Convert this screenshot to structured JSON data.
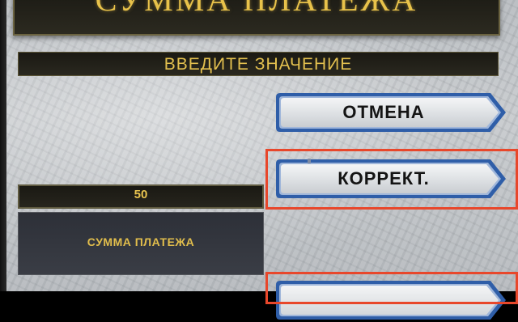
{
  "screen": {
    "title": "СУММА ПЛАТЕЖА",
    "subtitle": "ВВЕДИТЕ ЗНАЧЕНИЕ"
  },
  "buttons": {
    "cancel_label": "ОТМЕНА",
    "correct_label": "КОРРЕКТ."
  },
  "amount": {
    "value": "50",
    "label": "СУММА ПЛАТЕЖА"
  },
  "colors": {
    "accent_gold": "#e8c24a",
    "highlight_red": "#e8472b",
    "button_border_blue": "#2f5ea8"
  }
}
